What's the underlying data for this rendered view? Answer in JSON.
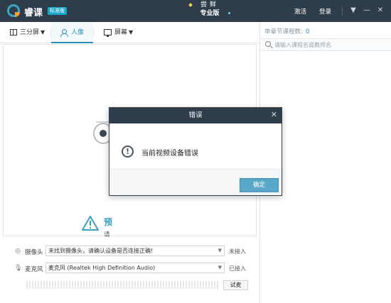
{
  "titlebar": {
    "app_name": "睿课",
    "edition_badge": "标准版",
    "promo_line1": "尝鲜",
    "promo_line2": "专业版",
    "activate_label": "激活",
    "login_label": "登录"
  },
  "toolbar": {
    "tabs": [
      {
        "label": "三分屏",
        "icon": "split-screen-icon"
      },
      {
        "label": "人像",
        "icon": "person-icon",
        "active": true
      },
      {
        "label": "屏幕",
        "icon": "monitor-icon"
      }
    ]
  },
  "preview": {
    "alert_title": "预",
    "alert_sub": "请"
  },
  "devices": {
    "camera_label": "摄像头",
    "camera_value": "未找到摄像头，请确认设备是否连接正确!",
    "camera_status": "未接入",
    "mic_label": "麦克风",
    "mic_value": "麦克风 (Realtek High Definition Audio)",
    "mic_status": "已接入",
    "test_label": "试麦",
    "mic_level": 0
  },
  "right_panel": {
    "header_label": "单章节课程数:",
    "course_count": "0",
    "search_placeholder": "请输入课程名或教师名"
  },
  "modal": {
    "title": "错误",
    "message": "当前视频设备错误",
    "ok_label": "确定"
  },
  "colors": {
    "titlebar_bg": "#2f3d4a",
    "accent": "#2a8fbd",
    "ok_button": "#5aa8c9"
  }
}
